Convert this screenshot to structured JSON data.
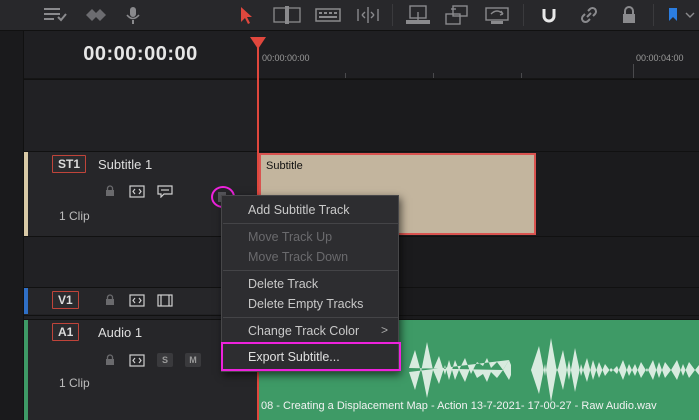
{
  "toolbar": {
    "icons": [
      "layout-icon",
      "flag-icon",
      "microphone-icon",
      "select-arrow-icon",
      "trim-icon",
      "blade-icon",
      "dynamic-trim-icon",
      "insert-icon",
      "overwrite-icon",
      "replace-icon",
      "snapping-magnet-icon",
      "link-icon",
      "lock-icon",
      "marker-flag-icon"
    ],
    "accent_color": "#e0473d"
  },
  "timecode": "00:00:00:00",
  "ruler": {
    "start_label": "00:00:00:00",
    "end_label": "00:00:04:00"
  },
  "tracks": {
    "subtitle": {
      "badge": "ST1",
      "name": "Subtitle 1",
      "clip_count": "1 Clip",
      "clip_label": "Subtitle"
    },
    "video": {
      "badge": "V1"
    },
    "audio": {
      "badge": "A1",
      "name": "Audio 1",
      "clip_count": "1 Clip",
      "solo_label": "S",
      "mute_label": "M",
      "clip_label": "08 - Creating a Displacement Map - Action 13-7-2021- 17-00-27 - Raw Audio.wav"
    }
  },
  "context_menu": {
    "items": [
      {
        "label": "Add Subtitle Track",
        "enabled": true
      },
      {
        "label": "Move Track Up",
        "enabled": false
      },
      {
        "label": "Move Track Down",
        "enabled": false
      },
      {
        "label": "Delete Track",
        "enabled": true
      },
      {
        "label": "Delete Empty Tracks",
        "enabled": true
      },
      {
        "label": "Change Track Color",
        "enabled": true,
        "submenu_arrow": ">"
      },
      {
        "label": "Export Subtitle...",
        "enabled": true
      }
    ]
  },
  "colors": {
    "subtitle_clip": "#c3b59e",
    "audio_clip": "#3e9a66",
    "highlight": "#ee22dd",
    "badge_border": "#c0443a"
  }
}
